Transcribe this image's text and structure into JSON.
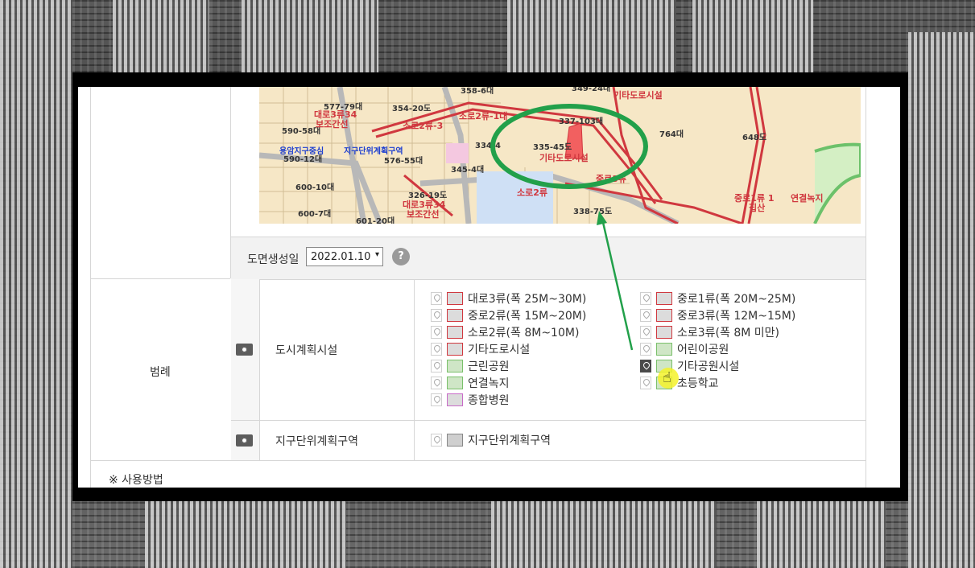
{
  "map": {
    "labels": [
      "358-6대",
      "349-24대",
      "기타도로시설",
      "577-79대",
      "354-20도",
      "대로3류34",
      "보조간선",
      "소로2류-3",
      "소로2류-1대",
      "590-58대",
      "용암지구중심",
      "지구단위계획구역",
      "576-55대",
      "590-12대",
      "334-4",
      "335-45도",
      "기타도로시설",
      "764대",
      "648도",
      "337-103대",
      "600-10대",
      "345-4대",
      "중로3류",
      "326-19도",
      "대로3류34",
      "보조간선",
      "600-7대",
      "601-20대",
      "338-75도",
      "소로2류",
      "중로1류 1",
      "집산",
      "연결녹지"
    ]
  },
  "date_row": {
    "label": "도면생성일",
    "selected": "2022.01.10",
    "help": "?"
  },
  "legend": {
    "title": "범례",
    "groups": [
      {
        "category": "도시계획시설",
        "items": [
          {
            "text": "대로3류(폭 25M~30M)",
            "swatch": "#dcdcdc",
            "border": "#d0383f"
          },
          {
            "text": "중로1류(폭 20M~25M)",
            "swatch": "#dcdcdc",
            "border": "#d0383f"
          },
          {
            "text": "중로2류(폭 15M~20M)",
            "swatch": "#dcdcdc",
            "border": "#d0383f"
          },
          {
            "text": "중로3류(폭 12M~15M)",
            "swatch": "#dcdcdc",
            "border": "#d0383f"
          },
          {
            "text": "소로2류(폭 8M~10M)",
            "swatch": "#dcdcdc",
            "border": "#d0383f"
          },
          {
            "text": "소로3류(폭 8M 미만)",
            "swatch": "#dcdcdc",
            "border": "#d0383f"
          },
          {
            "text": "기타도로시설",
            "swatch": "#dcdcdc",
            "border": "#d0383f"
          },
          {
            "text": "어린이공원",
            "swatch": "#cfe6c6",
            "border": "#7ac06b"
          },
          {
            "text": "근린공원",
            "swatch": "#cfe6c6",
            "border": "#7ac06b"
          },
          {
            "text": "기타공원시설",
            "swatch": "#cfe6c6",
            "border": "#7ac06b"
          },
          {
            "text": "연결녹지",
            "swatch": "#cfe6c6",
            "border": "#7ac06b"
          },
          {
            "text": "초등학교",
            "swatch": "#cfe6c6",
            "border": "#7ac06b"
          },
          {
            "text": "종합병원",
            "swatch": "#dcdcdc",
            "border": "#c86ac8"
          }
        ]
      },
      {
        "category": "지구단위계획구역",
        "items": [
          {
            "text": "지구단위계획구역",
            "swatch": "#cfcfcf",
            "border": "#888888"
          }
        ]
      }
    ]
  },
  "usage": "※ 사용방법",
  "colors": {
    "annotation": "#22a04a",
    "road": "#d0383f",
    "map_bg": "#f6e7c6"
  }
}
